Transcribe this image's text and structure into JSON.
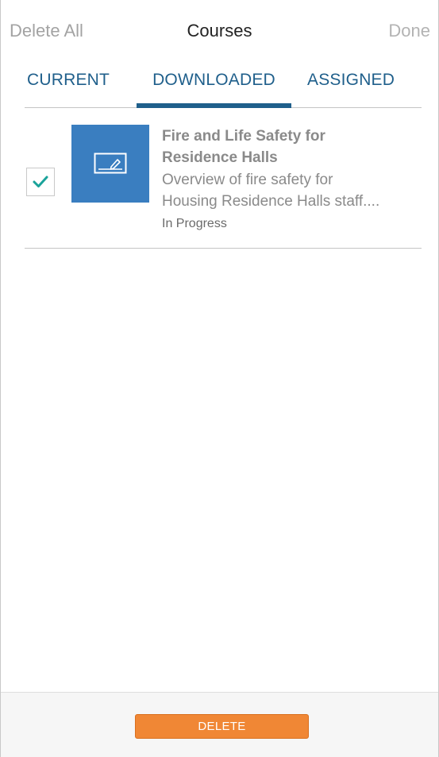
{
  "navbar": {
    "left_action": "Delete All",
    "title": "Courses",
    "right_action": "Done"
  },
  "tabs": [
    {
      "label": "CURRENT",
      "selected": false
    },
    {
      "label": "DOWNLOADED",
      "selected": true
    },
    {
      "label": "ASSIGNED",
      "selected": false
    }
  ],
  "courses": [
    {
      "title_line1": "Fire and Life Safety for",
      "title_line2": "Residence Halls",
      "desc_line1": "Overview of fire safety for",
      "desc_line2": "Housing Residence Halls staff....",
      "status": "In Progress",
      "checked": true,
      "thumbnail_icon": "pencil-card-icon"
    }
  ],
  "footer": {
    "delete_label": "DELETE"
  },
  "colors": {
    "accent": "#1f5f8b",
    "thumbnail": "#3a7ec0",
    "check": "#1aa39a",
    "delete_button": "#f08735"
  }
}
